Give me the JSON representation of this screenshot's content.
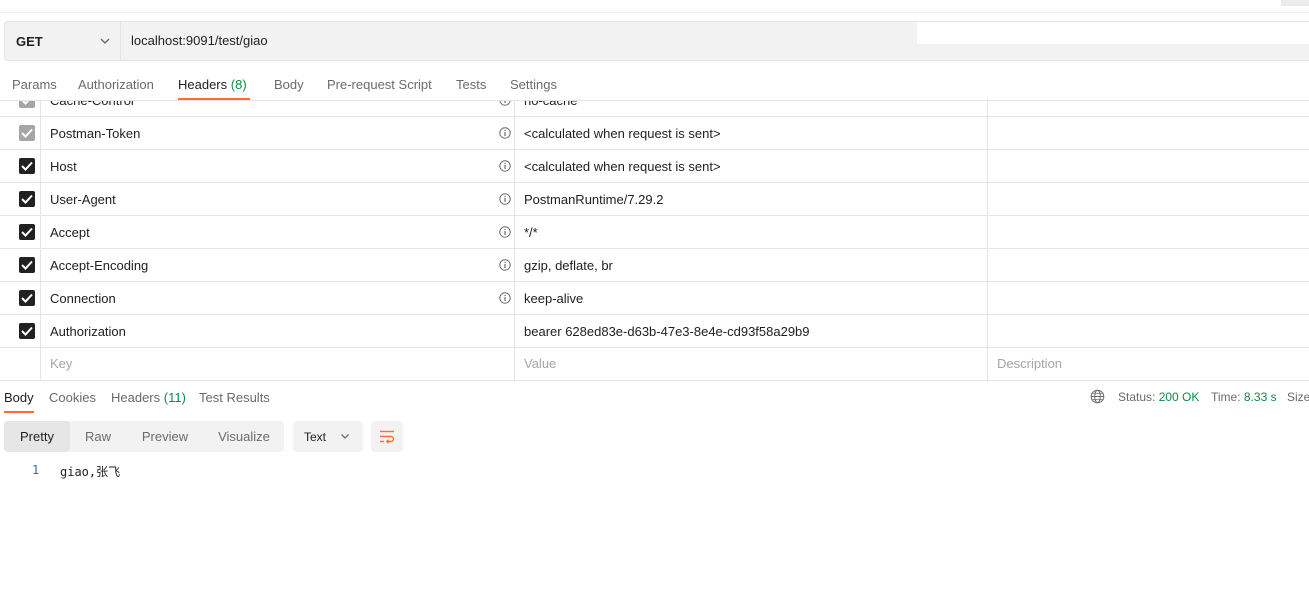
{
  "request": {
    "method": "GET",
    "url": "localhost:9091/test/giao"
  },
  "request_tabs": [
    {
      "label": "Params"
    },
    {
      "label": "Authorization"
    },
    {
      "label": "Headers",
      "count": "(8)"
    },
    {
      "label": "Body"
    },
    {
      "label": "Pre-request Script"
    },
    {
      "label": "Tests"
    },
    {
      "label": "Settings"
    }
  ],
  "headers": {
    "rows": [
      {
        "key": "Cache-Control",
        "value": "no-cache",
        "state": "disabled"
      },
      {
        "key": "Postman-Token",
        "value": "<calculated when request is sent>",
        "state": "disabled"
      },
      {
        "key": "Host",
        "value": "<calculated when request is sent>",
        "state": "checked"
      },
      {
        "key": "User-Agent",
        "value": "PostmanRuntime/7.29.2",
        "state": "checked"
      },
      {
        "key": "Accept",
        "value": "*/*",
        "state": "checked"
      },
      {
        "key": "Accept-Encoding",
        "value": "gzip, deflate, br",
        "state": "checked"
      },
      {
        "key": "Connection",
        "value": "keep-alive",
        "state": "checked"
      },
      {
        "key": "Authorization",
        "value": "bearer 628ed83e-d63b-47e3-8e4e-cd93f58a29b9",
        "state": "checked"
      }
    ],
    "placeholders": {
      "key": "Key",
      "value": "Value",
      "description": "Description"
    }
  },
  "response_tabs": [
    {
      "label": "Body"
    },
    {
      "label": "Cookies"
    },
    {
      "label": "Headers",
      "count": "(11)"
    },
    {
      "label": "Test Results"
    }
  ],
  "status": {
    "status_label": "Status:",
    "status_value": "200 OK",
    "time_label": "Time:",
    "time_value": "8.33 s",
    "size_label": "Size"
  },
  "view_modes": [
    "Pretty",
    "Raw",
    "Preview",
    "Visualize"
  ],
  "format": "Text",
  "body_lines": [
    {
      "no": "1",
      "text": "giao,张飞"
    }
  ],
  "colors": {
    "accent": "#ff6c37",
    "success": "#0f8a4a",
    "line_number": "#2f6ea8"
  }
}
